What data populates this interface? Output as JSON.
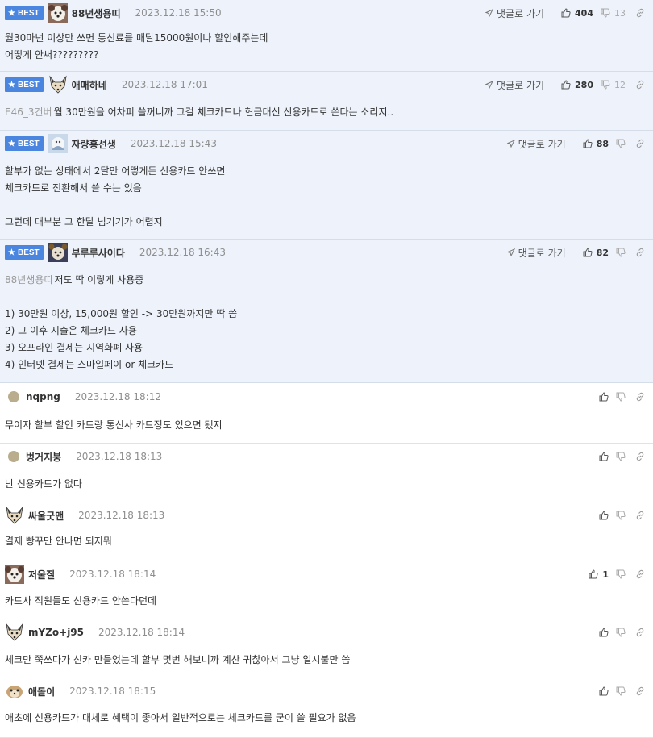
{
  "best_label": "BEST",
  "reply_label": "댓글로 가기",
  "comments": [
    {
      "nick": "88년생용띠",
      "date": "2023.12.18 15:50",
      "best": true,
      "up": "404",
      "down": "13",
      "mention": "",
      "text": "월30마넌 이상만 쓰면 통신료를 매달15000원이나 할인해주는데\n어떻게 안써?????????",
      "avatar": "dog-photo"
    },
    {
      "nick": "애매하네",
      "date": "2023.12.18 17:01",
      "best": true,
      "up": "280",
      "down": "12",
      "mention": "E46_3컨버",
      "text": "월 30만원을 어차피 쓸꺼니까 그걸 체크카드나 현금대신 신용카드로 쓴다는 소리지..",
      "avatar": "fox"
    },
    {
      "nick": "자량홍선생",
      "date": "2023.12.18 15:43",
      "best": true,
      "up": "88",
      "down": "",
      "mention": "",
      "text": "할부가 없는 상태에서 2달만 어떻게든 신용카드 안쓰면\n체크카드로 전환해서 쓸 수는 있음\n\n그런데 대부분 그 한달 넘기기가 어렵지",
      "avatar": "blue-photo"
    },
    {
      "nick": "부루루사이다",
      "date": "2023.12.18 16:43",
      "best": true,
      "up": "82",
      "down": "",
      "mention": "88년생용띠",
      "text": "저도 딱 이렇게 사용중\n\n1) 30만원 이상, 15,000원 할인 -> 30만원까지만 딱 씀\n2) 그 이후 지출은 체크카드 사용\n3) 오프라인 결제는 지역화폐 사용\n4) 인터넷 결제는 스마일페이 or 체크카드",
      "avatar": "dark-photo"
    },
    {
      "nick": "nqpng",
      "date": "2023.12.18 18:12",
      "best": false,
      "up": "",
      "down": "",
      "mention": "",
      "text": "무이자 할부 할인 카드랑 통신사 카드정도 있으면 됐지",
      "avatar": "dot"
    },
    {
      "nick": "벙거지붕",
      "date": "2023.12.18 18:13",
      "best": false,
      "up": "",
      "down": "",
      "mention": "",
      "text": "난 신용카드가 없다",
      "avatar": "dot"
    },
    {
      "nick": "싸울굿맨",
      "date": "2023.12.18 18:13",
      "best": false,
      "up": "",
      "down": "",
      "mention": "",
      "text": "결제 빵꾸만 안나면 되지뭐",
      "avatar": "fox"
    },
    {
      "nick": "저울질",
      "date": "2023.12.18 18:14",
      "best": false,
      "up": "1",
      "down": "",
      "mention": "",
      "text": "카드사 직원들도 신용카드 안쓴다던데",
      "avatar": "dog-photo"
    },
    {
      "nick": "mYZo+j95",
      "date": "2023.12.18 18:14",
      "best": false,
      "up": "",
      "down": "",
      "mention": "",
      "text": "체크만 쭉쓰다가 신카 만들었는데 할부 몇번 해보니까 계산 귀찮아서 그냥 일시불만 씀",
      "avatar": "fox"
    },
    {
      "nick": "애돌이",
      "date": "2023.12.18 18:15",
      "best": false,
      "up": "",
      "down": "",
      "mention": "",
      "text": "애초에 신용카드가 대체로 혜택이 좋아서 일반적으로는 체크카드를 굳이 쓸 필요가 없음",
      "avatar": "meerkat"
    }
  ]
}
